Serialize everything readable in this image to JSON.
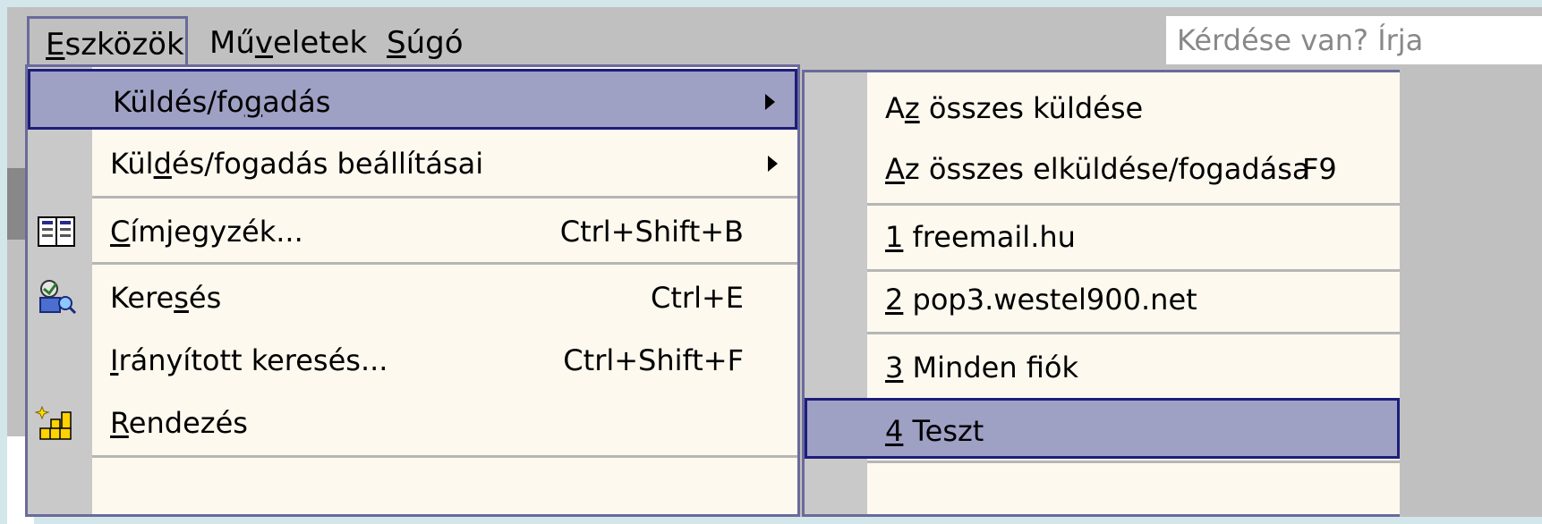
{
  "menubar": {
    "eszkozok": {
      "pre": "",
      "ul": "E",
      "post": "szközök"
    },
    "muveletek": {
      "pre": "Mű",
      "ul": "v",
      "post": "eletek"
    },
    "sugo": {
      "pre": "",
      "ul": "S",
      "post": "úgó"
    },
    "help_placeholder": "Kérdése van? Írja"
  },
  "dropdown": {
    "items": [
      {
        "pre": "Küldés/fo",
        "ul": "g",
        "post": "adás",
        "shortcut": "",
        "has_submenu": true,
        "icon": ""
      },
      {
        "pre": "Kül",
        "ul": "d",
        "post": "és/fogadás beállításai",
        "shortcut": "",
        "has_submenu": true,
        "icon": ""
      },
      {
        "pre": "",
        "ul": "C",
        "post": "ímjegyzék...",
        "shortcut": "Ctrl+Shift+B",
        "icon": "address-book-icon"
      },
      {
        "pre": "Kere",
        "ul": "s",
        "post": "és",
        "shortcut": "Ctrl+E",
        "icon": "find-icon"
      },
      {
        "pre": "",
        "ul": "I",
        "post": "rányított keresés...",
        "shortcut": "Ctrl+Shift+F",
        "icon": ""
      },
      {
        "pre": "",
        "ul": "R",
        "post": "endezés",
        "shortcut": "",
        "icon": "organize-icon"
      }
    ]
  },
  "submenu": {
    "items": [
      {
        "pre": "A",
        "ul": "z",
        "post": " összes küldése",
        "shortcut": ""
      },
      {
        "pre": "",
        "ul": "A",
        "post": "z összes elküldése/fogadása",
        "shortcut": "F9"
      },
      {
        "pre": "",
        "ul": "1",
        "post": " freemail.hu",
        "shortcut": ""
      },
      {
        "pre": "",
        "ul": "2",
        "post": " pop3.westel900.net",
        "shortcut": ""
      },
      {
        "pre": "",
        "ul": "3",
        "post": " Minden fiók",
        "shortcut": ""
      },
      {
        "pre": "",
        "ul": "4",
        "post": " Teszt",
        "shortcut": ""
      }
    ]
  },
  "colors": {
    "menu_bg": "#fdf9ef",
    "highlight": "#9ea0c4",
    "highlight_border": "#1d1d7a",
    "chrome": "#c0c0c0"
  }
}
